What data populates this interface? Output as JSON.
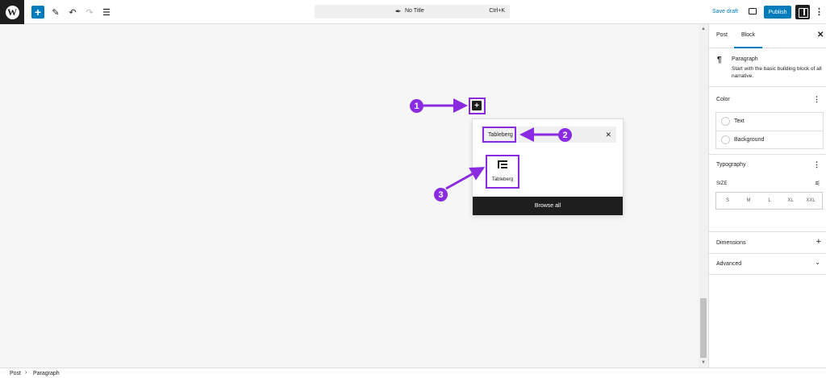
{
  "toolbar": {
    "logo": "W",
    "add_icon": "+",
    "edit_icon": "✎",
    "undo_icon": "↶",
    "redo_icon": "↷",
    "list_view_icon": "☰",
    "title": "No Title",
    "feather_icon": "✒",
    "shortcut": "Ctrl+K",
    "save_draft": "Save draft",
    "publish": "Publish",
    "options_icon": "⋮"
  },
  "canvas": {
    "inserter_icon": "+"
  },
  "inserter": {
    "search_value": "Tableberg",
    "clear_icon": "✕",
    "result_label": "Tableberg",
    "browse_all": "Browse all"
  },
  "annotations": {
    "step1": "1",
    "step2": "2",
    "step3": "3",
    "color": "#8a2be2"
  },
  "sidebar": {
    "tab_post": "Post",
    "tab_block": "Block",
    "close_icon": "✕",
    "block_icon": "¶",
    "block_title": "Paragraph",
    "block_desc": "Start with the basic building block of all narrative.",
    "color_title": "Color",
    "color_text": "Text",
    "color_background": "Background",
    "menu_icon": "⋮",
    "typography_title": "Typography",
    "size_label": "SIZE",
    "size_options": [
      "S",
      "M",
      "L",
      "XL",
      "XXL"
    ],
    "size_ctrl_icon": "⚟",
    "dimensions_title": "Dimensions",
    "plus_icon": "+",
    "advanced_title": "Advanced",
    "chevron_icon": "⌄"
  },
  "footer": {
    "crumb1": "Post",
    "sep": "›",
    "crumb2": "Paragraph"
  },
  "colors": {
    "accent": "#007cba",
    "dark": "#1e1e1e"
  }
}
